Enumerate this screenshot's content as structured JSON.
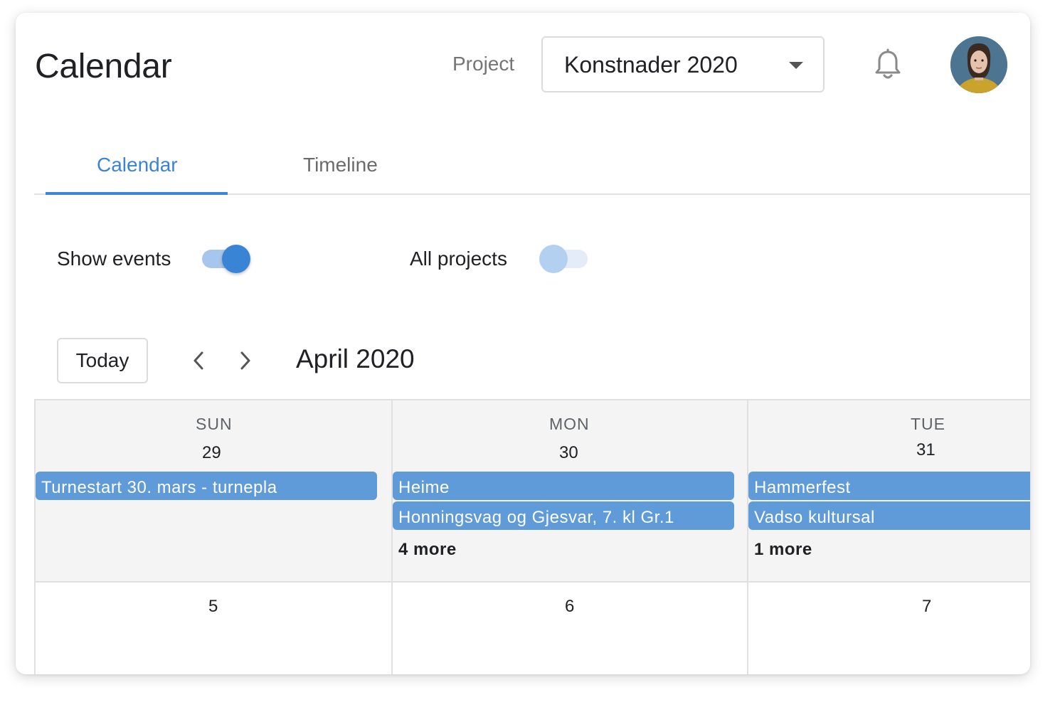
{
  "header": {
    "title": "Calendar",
    "project_label": "Project",
    "project_value": "Konstnader 2020"
  },
  "icons": {
    "notifications": "bell-icon",
    "dropdown": "caret-down-icon",
    "prev": "chevron-left-icon",
    "next": "chevron-right-icon"
  },
  "tabs": [
    {
      "label": "Calendar",
      "active": true
    },
    {
      "label": "Timeline",
      "active": false
    }
  ],
  "toggles": {
    "show_events": {
      "label": "Show events",
      "on": true
    },
    "all_projects": {
      "label": "All projects",
      "on": false
    }
  },
  "toolbar": {
    "today_label": "Today",
    "month_label": "April 2020"
  },
  "calendar": {
    "weeks": [
      {
        "days": [
          {
            "dow": "SUN",
            "date": "29",
            "events": [
              "Turnestart 30. mars - turnepla"
            ],
            "more": ""
          },
          {
            "dow": "MON",
            "date": "30",
            "events": [
              "Heime",
              "Honningsvag og Gjesvar, 7. kl Gr.1"
            ],
            "more": "4 more"
          },
          {
            "dow": "TUE",
            "date": "31",
            "events": [
              "Hammerfest",
              "Vadso kultursal"
            ],
            "more": "1 more"
          }
        ]
      },
      {
        "days": [
          {
            "date": "5"
          },
          {
            "date": "6"
          },
          {
            "date": "7"
          }
        ]
      }
    ]
  },
  "colors": {
    "accent": "#3a84d6",
    "event": "#5f9ad9",
    "past_day_bg": "#f4f4f4"
  }
}
